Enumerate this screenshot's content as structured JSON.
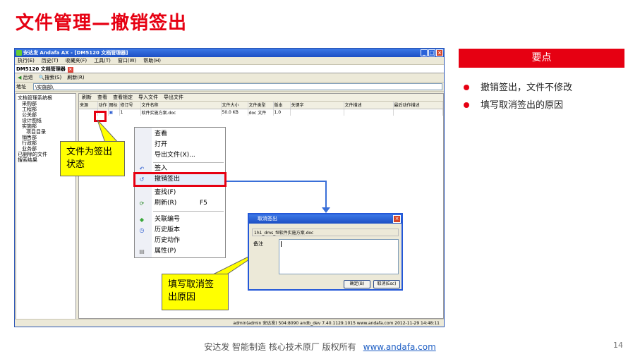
{
  "slide": {
    "title": "文件管理—撤销签出",
    "key_header": "要点",
    "key_points": [
      "撤销签出，文件不修改",
      "填写取消签出的原因"
    ],
    "footer_text": "安达发  智能制造 核心技术原厂   版权所有",
    "footer_url": "www.andafa.com",
    "page_number": "14",
    "accent_color": "#e60012"
  },
  "window": {
    "title": "安达发 Andafa AX - [DM5120 文档管理器]",
    "menu": [
      "执行(E)",
      "历史(T)",
      "收藏夹(F)",
      "工具(T)",
      "窗口(W)",
      "帮助(H)"
    ],
    "tab_title": "DM5120 文档管理器",
    "toolbar": [
      "后退",
      "搜索(S)",
      "刷新(R)"
    ],
    "address_label": "地址",
    "address_value": "\\实施部\\",
    "tree": {
      "root": "文档管理系统根",
      "items": [
        "采购部",
        "工程部",
        "公关部",
        "设计图纸",
        "实施部",
        "项目目录",
        "销售部",
        "行政部",
        "业务部"
      ],
      "deleted": "已删除的文件",
      "search_results": "搜索结果"
    },
    "content_toolbar": [
      "刷新",
      "查看",
      "查看锁定",
      "导入文件",
      "导出文件"
    ],
    "columns": [
      "来源",
      "动作",
      "图标",
      "修订号",
      "文件名称",
      "文件大小",
      "文件类型",
      "版本",
      "关键字",
      "文件描述",
      "最后动作描述"
    ],
    "row": {
      "revision": "1",
      "filename": "软件实施方案.doc",
      "size": "50.0 KB",
      "type": "doc 文件",
      "version": "1.0"
    },
    "status": "admin(admin 安达发)  504:8090  andb_dev  7.40.1129.1015  www.andafa.com  2012-11-29 14:48:11"
  },
  "context_menu": {
    "items": [
      {
        "label": "查看",
        "icon": ""
      },
      {
        "label": "打开",
        "icon": ""
      },
      {
        "label": "导出文件(X)...",
        "icon": ""
      },
      {
        "label": "签入",
        "icon": "check-in-icon"
      },
      {
        "label": "撤销签出",
        "icon": "undo-icon"
      },
      {
        "label": "查找(F)",
        "icon": ""
      },
      {
        "label": "刷新(R)",
        "shortcut": "F5",
        "icon": "refresh-icon"
      },
      {
        "label": "关联编号",
        "icon": "link-icon"
      },
      {
        "label": "历史版本",
        "icon": "history-icon"
      },
      {
        "label": "历史动作",
        "icon": ""
      },
      {
        "label": "属性(P)",
        "icon": "properties-icon"
      }
    ]
  },
  "dialog": {
    "title": "取消签出",
    "file": "1h1_dms_fil软件实施方案.doc",
    "memo_label": "备注",
    "ok_button": "确定(B)",
    "cancel_button": "取消(Esc)"
  },
  "callouts": {
    "checked_out": "文件为签出状态",
    "fill_reason": "填写取消签出原因"
  }
}
